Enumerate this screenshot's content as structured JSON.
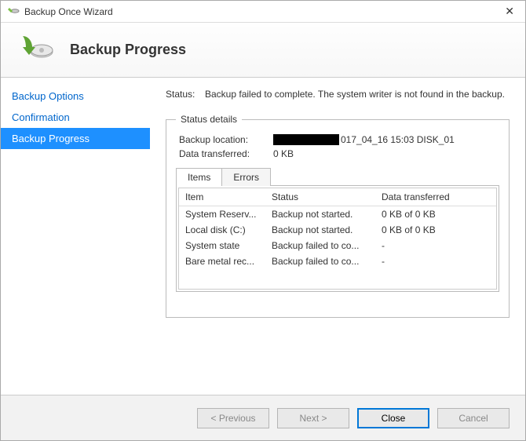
{
  "window": {
    "title": "Backup Once Wizard"
  },
  "header": {
    "title": "Backup Progress"
  },
  "sidebar": {
    "items": [
      {
        "label": "Backup Options",
        "selected": false
      },
      {
        "label": "Confirmation",
        "selected": false
      },
      {
        "label": "Backup Progress",
        "selected": true
      }
    ]
  },
  "status": {
    "label": "Status:",
    "message": "Backup failed to complete. The system writer is not found in the backup."
  },
  "details": {
    "legend": "Status details",
    "backup_location_label": "Backup location:",
    "backup_location_suffix": "017_04_16 15:03 DISK_01",
    "data_transferred_label": "Data transferred:",
    "data_transferred_value": "0 KB"
  },
  "tabs": {
    "items_label": "Items",
    "errors_label": "Errors"
  },
  "table": {
    "headers": {
      "item": "Item",
      "status": "Status",
      "transferred": "Data transferred"
    },
    "rows": [
      {
        "item": "System Reserv...",
        "status": "Backup not started.",
        "transferred": "0 KB of 0 KB"
      },
      {
        "item": "Local disk (C:)",
        "status": "Backup not started.",
        "transferred": "0 KB of 0 KB"
      },
      {
        "item": "System state",
        "status": "Backup failed to co...",
        "transferred": "-"
      },
      {
        "item": "Bare metal rec...",
        "status": "Backup failed to co...",
        "transferred": "-"
      }
    ]
  },
  "buttons": {
    "previous": "< Previous",
    "next": "Next >",
    "close": "Close",
    "cancel": "Cancel"
  }
}
